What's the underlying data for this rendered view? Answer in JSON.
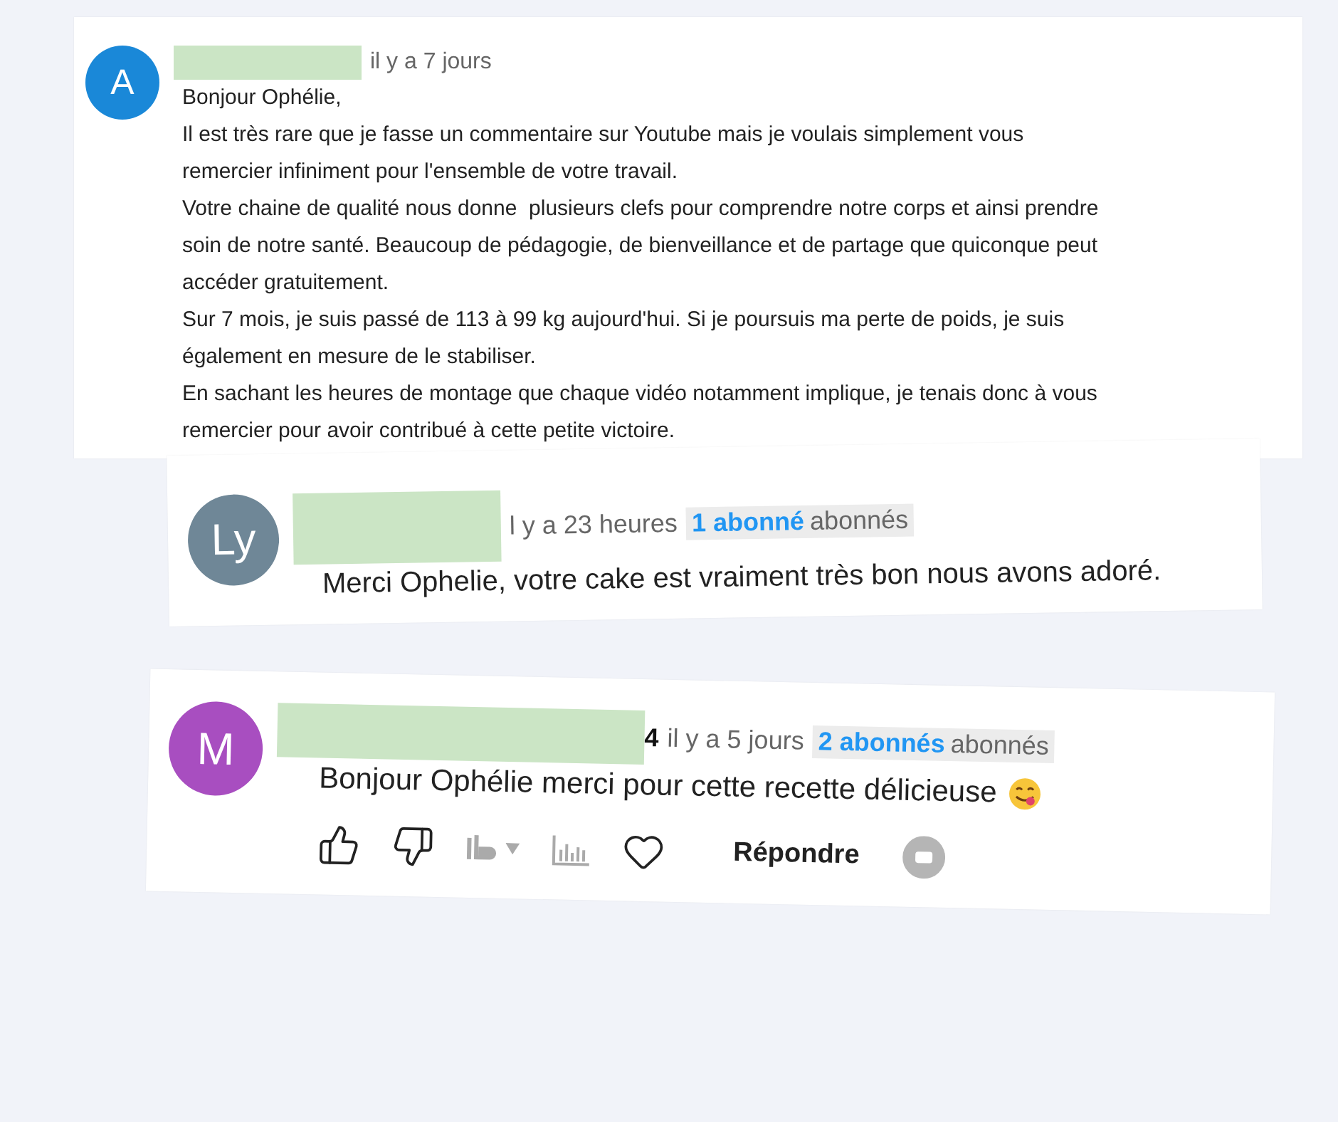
{
  "comments": [
    {
      "avatar": {
        "letter": "A",
        "color": "#1a88d8"
      },
      "time": "il y a 7 jours",
      "lines": [
        "Bonjour Ophélie,",
        "Il est très rare que je fasse un commentaire sur Youtube mais je voulais simplement vous",
        "remercier infiniment pour l'ensemble de votre travail.",
        "Votre chaine de qualité nous donne  plusieurs clefs pour comprendre notre corps et ainsi prendre",
        "soin de notre santé. Beaucoup de pédagogie, de bienveillance et de partage que quiconque peut",
        "accéder gratuitement.",
        "Sur 7 mois, je suis passé de 113 à 99 kg aujourd'hui. Si je poursuis ma perte de poids, je suis",
        "également en mesure de le stabiliser.",
        "En sachant les heures de montage que chaque vidéo notamment implique, je tenais donc à vous",
        "remercier pour avoir contribué à cette petite victoire."
      ]
    },
    {
      "avatar": {
        "letter": "Ly",
        "color": "#6f8797"
      },
      "time": "l y a 23 heures",
      "subscribers": {
        "count": "1 abonné",
        "label": "abonnés"
      },
      "lines": [
        "Merci Ophelie, votre cake est vraiment très bon nous avons adoré."
      ]
    },
    {
      "avatar": {
        "letter": "M",
        "color": "#a84ec0"
      },
      "name_suffix": "4",
      "time": "il y a 5 jours",
      "subscribers": {
        "count": "2 abonnés",
        "label": "abonnés"
      },
      "lines": [
        "Bonjour Ophélie merci pour cette recette délicieuse"
      ],
      "emoji": true,
      "actions": {
        "reply": "Répondre"
      }
    }
  ]
}
